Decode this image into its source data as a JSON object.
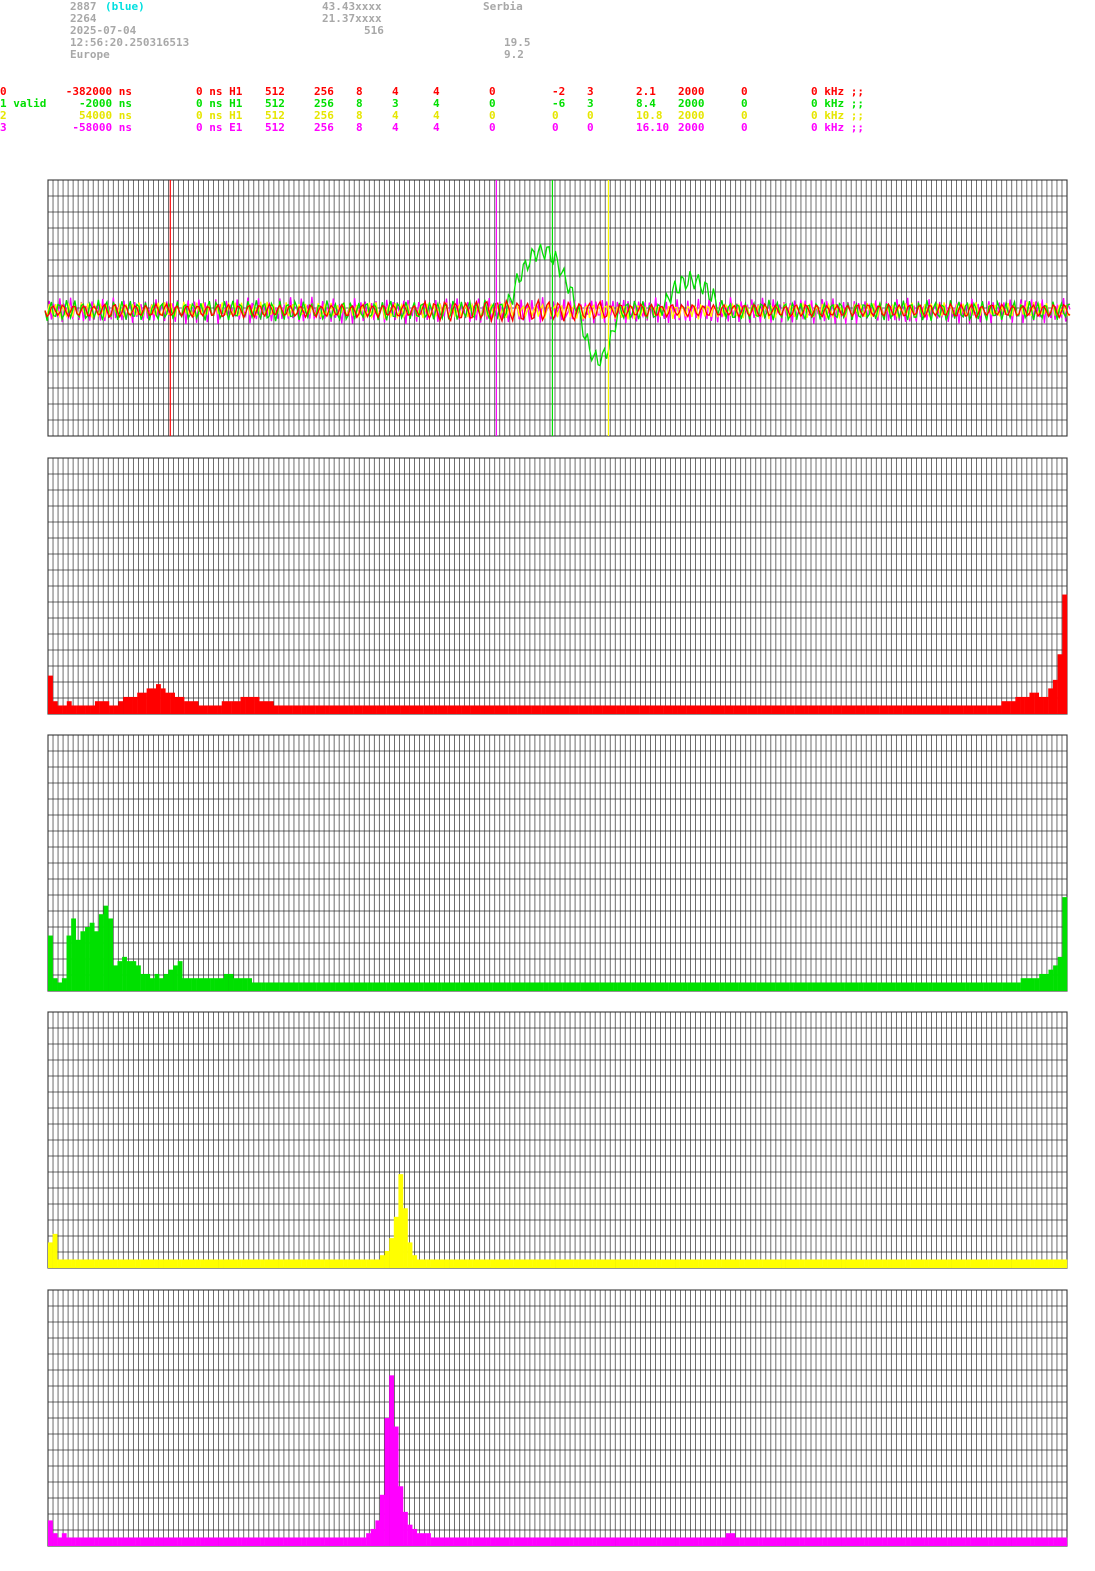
{
  "header": {
    "station_id": "2887",
    "station_color": "(blue)",
    "station_num": "2264",
    "date": "2025-07-04",
    "time": "12:56:20.250316513",
    "region": "Europe",
    "lat": "43.43xxxx",
    "lon": "21.37xxxx",
    "alt": "516",
    "country": "Serbia",
    "val1": "19.5",
    "val2": "9.2"
  },
  "colors": {
    "ch0": "#ff0000",
    "ch1": "#00e000",
    "ch2": "#ffff00",
    "ch3": "#ff00ff"
  },
  "channels": [
    {
      "cols": [
        "0",
        "-382000 ns",
        "0 ns H1",
        "512",
        "256",
        "8",
        "4",
        "4",
        "0",
        "-2",
        "3",
        "2.1",
        "2000",
        "0",
        "0 kHz ;;"
      ]
    },
    {
      "cols": [
        "1 valid",
        "-2000 ns",
        "0 ns H1",
        "512",
        "256",
        "8",
        "3",
        "4",
        "0",
        "-6",
        "3",
        "8.4",
        "2000",
        "0",
        "0 kHz ;;"
      ]
    },
    {
      "cols": [
        "2",
        "54000 ns",
        "0 ns H1",
        "512",
        "256",
        "8",
        "4",
        "4",
        "0",
        "0",
        "0",
        "10.8",
        "2000",
        "0",
        "0 kHz ;;"
      ]
    },
    {
      "cols": [
        "3",
        "-58000 ns",
        "0 ns E1",
        "512",
        "256",
        "8",
        "4",
        "4",
        "0",
        "0",
        "0",
        "16.10",
        "2000",
        "0",
        "0 kHz ;;"
      ]
    }
  ],
  "chart_data": [
    {
      "type": "line",
      "markers": [
        {
          "channel": 0,
          "position": 0.12
        },
        {
          "channel": 3,
          "position": 0.44
        },
        {
          "channel": 1,
          "position": 0.495
        },
        {
          "channel": 2,
          "position": 0.55
        }
      ],
      "grid": true
    },
    {
      "type": "bar",
      "channel": 0,
      "grid": true,
      "values": [
        9,
        3,
        2,
        2,
        3,
        2,
        2,
        2,
        2,
        2,
        3,
        3,
        3,
        2,
        2,
        3,
        4,
        4,
        4,
        5,
        5,
        6,
        6,
        7,
        6,
        5,
        5,
        4,
        4,
        3,
        3,
        3,
        2,
        2,
        2,
        2,
        2,
        3,
        3,
        3,
        3,
        4,
        4,
        4,
        4,
        3,
        3,
        3,
        2,
        2,
        2,
        2,
        2,
        2,
        2,
        2,
        2,
        2,
        2,
        2,
        2,
        2,
        2,
        2,
        2,
        2,
        2,
        2,
        2,
        2,
        2,
        2,
        2,
        2,
        2,
        2,
        2,
        2,
        2,
        2,
        2,
        2,
        2,
        2,
        2,
        2,
        2,
        2,
        2,
        2,
        2,
        2,
        2,
        2,
        2,
        2,
        2,
        2,
        2,
        2,
        2,
        2,
        2,
        2,
        2,
        2,
        2,
        2,
        2,
        2,
        2,
        2,
        2,
        2,
        2,
        2,
        2,
        2,
        2,
        2,
        2,
        2,
        2,
        2,
        2,
        2,
        2,
        2,
        2,
        2,
        2,
        2,
        2,
        2,
        2,
        2,
        2,
        2,
        2,
        2,
        2,
        2,
        2,
        2,
        2,
        2,
        2,
        2,
        2,
        2,
        2,
        2,
        2,
        2,
        2,
        2,
        2,
        2,
        2,
        2,
        2,
        2,
        2,
        2,
        2,
        2,
        2,
        2,
        2,
        2,
        2,
        2,
        2,
        2,
        2,
        2,
        2,
        2,
        2,
        2,
        2,
        2,
        2,
        2,
        2,
        2,
        2,
        2,
        2,
        2,
        2,
        2,
        2,
        2,
        2,
        2,
        2,
        2,
        2,
        2,
        2,
        2,
        2,
        3,
        3,
        3,
        4,
        4,
        4,
        5,
        5,
        4,
        4,
        6,
        8,
        14,
        28
      ]
    },
    {
      "type": "bar",
      "channel": 1,
      "grid": true,
      "values": [
        13,
        3,
        2,
        3,
        13,
        17,
        12,
        14,
        15,
        16,
        14,
        18,
        20,
        17,
        6,
        7,
        8,
        7,
        7,
        6,
        4,
        4,
        3,
        4,
        3,
        4,
        5,
        6,
        7,
        3,
        3,
        3,
        3,
        3,
        3,
        3,
        3,
        3,
        4,
        4,
        3,
        3,
        3,
        3,
        2,
        2,
        2,
        2,
        2,
        2,
        2,
        2,
        2,
        2,
        2,
        2,
        2,
        2,
        2,
        2,
        2,
        2,
        2,
        2,
        2,
        2,
        2,
        2,
        2,
        2,
        2,
        2,
        2,
        2,
        2,
        2,
        2,
        2,
        2,
        2,
        2,
        2,
        2,
        2,
        2,
        2,
        2,
        2,
        2,
        2,
        2,
        2,
        2,
        2,
        2,
        2,
        2,
        2,
        2,
        2,
        2,
        2,
        2,
        2,
        2,
        2,
        2,
        2,
        2,
        2,
        2,
        2,
        2,
        2,
        2,
        2,
        2,
        2,
        2,
        2,
        2,
        2,
        2,
        2,
        2,
        2,
        2,
        2,
        2,
        2,
        2,
        2,
        2,
        2,
        2,
        2,
        2,
        2,
        2,
        2,
        2,
        2,
        2,
        2,
        2,
        2,
        2,
        2,
        2,
        2,
        2,
        2,
        2,
        2,
        2,
        2,
        2,
        2,
        2,
        2,
        2,
        2,
        2,
        2,
        2,
        2,
        2,
        2,
        2,
        2,
        2,
        2,
        2,
        2,
        2,
        2,
        2,
        2,
        2,
        2,
        2,
        2,
        2,
        2,
        2,
        2,
        2,
        2,
        2,
        2,
        2,
        2,
        2,
        2,
        2,
        2,
        2,
        2,
        2,
        2,
        2,
        2,
        2,
        2,
        2,
        2,
        2,
        2,
        2,
        2,
        3,
        3,
        3,
        3,
        4,
        4,
        5,
        6,
        8,
        22
      ]
    },
    {
      "type": "bar",
      "channel": 2,
      "grid": true,
      "values": [
        6,
        8,
        2,
        2,
        2,
        2,
        2,
        2,
        2,
        2,
        2,
        2,
        2,
        2,
        2,
        2,
        2,
        2,
        2,
        2,
        2,
        2,
        2,
        2,
        2,
        2,
        2,
        2,
        2,
        2,
        2,
        2,
        2,
        2,
        2,
        2,
        2,
        2,
        2,
        2,
        2,
        2,
        2,
        2,
        2,
        2,
        2,
        2,
        2,
        2,
        2,
        2,
        2,
        2,
        2,
        2,
        2,
        2,
        2,
        2,
        2,
        2,
        2,
        2,
        2,
        2,
        2,
        2,
        2,
        2,
        2,
        2,
        3,
        4,
        7,
        12,
        22,
        14,
        6,
        3,
        2,
        2,
        2,
        2,
        2,
        2,
        2,
        2,
        2,
        2,
        2,
        2,
        2,
        2,
        2,
        2,
        2,
        2,
        2,
        2,
        2,
        2,
        2,
        2,
        2,
        2,
        2,
        2,
        2,
        2,
        2,
        2,
        2,
        2,
        2,
        2,
        2,
        2,
        2,
        2,
        2,
        2,
        2,
        2,
        2,
        2,
        2,
        2,
        2,
        2,
        2,
        2,
        2,
        2,
        2,
        2,
        2,
        2,
        2,
        2,
        2,
        2,
        2,
        2,
        2,
        2,
        2,
        2,
        2,
        2,
        2,
        2,
        2,
        2,
        2,
        2,
        2,
        2,
        2,
        2,
        2,
        2,
        2,
        2,
        2,
        2,
        2,
        2,
        2,
        2,
        2,
        2,
        2,
        2,
        2,
        2,
        2,
        2,
        2,
        2,
        2,
        2,
        2,
        2,
        2,
        2,
        2,
        2,
        2,
        2,
        2,
        2,
        2,
        2,
        2,
        2,
        2,
        2,
        2,
        2,
        2,
        2,
        2,
        2,
        2,
        2,
        2,
        2,
        2,
        2,
        2,
        2,
        2,
        2,
        2,
        2,
        2,
        2,
        2,
        2,
        2
      ]
    },
    {
      "type": "bar",
      "channel": 3,
      "grid": true,
      "values": [
        6,
        3,
        2,
        3,
        2,
        2,
        2,
        2,
        2,
        2,
        2,
        2,
        2,
        2,
        2,
        2,
        2,
        2,
        2,
        2,
        2,
        2,
        2,
        2,
        2,
        2,
        2,
        2,
        2,
        2,
        2,
        2,
        2,
        2,
        2,
        2,
        2,
        2,
        2,
        2,
        2,
        2,
        2,
        2,
        2,
        2,
        2,
        2,
        2,
        2,
        2,
        2,
        2,
        2,
        2,
        2,
        2,
        2,
        2,
        2,
        2,
        2,
        2,
        2,
        2,
        2,
        2,
        2,
        2,
        3,
        4,
        6,
        12,
        30,
        40,
        28,
        14,
        8,
        5,
        4,
        3,
        3,
        3,
        2,
        2,
        2,
        2,
        2,
        2,
        2,
        2,
        2,
        2,
        2,
        2,
        2,
        2,
        2,
        2,
        2,
        2,
        2,
        2,
        2,
        2,
        2,
        2,
        2,
        2,
        2,
        2,
        2,
        2,
        2,
        2,
        2,
        2,
        2,
        2,
        2,
        2,
        2,
        2,
        2,
        2,
        2,
        2,
        2,
        2,
        2,
        2,
        2,
        2,
        2,
        2,
        2,
        2,
        2,
        2,
        2,
        2,
        2,
        2,
        2,
        2,
        2,
        2,
        3,
        3,
        2,
        2,
        2,
        2,
        2,
        2,
        2,
        2,
        2,
        2,
        2,
        2,
        2,
        2,
        2,
        2,
        2,
        2,
        2,
        2,
        2,
        2,
        2,
        2,
        2,
        2,
        2,
        2,
        2,
        2,
        2,
        2,
        2,
        2,
        2,
        2,
        2,
        2,
        2,
        2,
        2,
        2,
        2,
        2,
        2,
        2,
        2,
        2,
        2,
        2,
        2,
        2,
        2,
        2,
        2,
        2,
        2,
        2,
        2,
        2,
        2,
        2,
        2,
        2,
        2,
        2,
        2,
        2,
        2,
        2,
        2,
        2
      ]
    }
  ]
}
